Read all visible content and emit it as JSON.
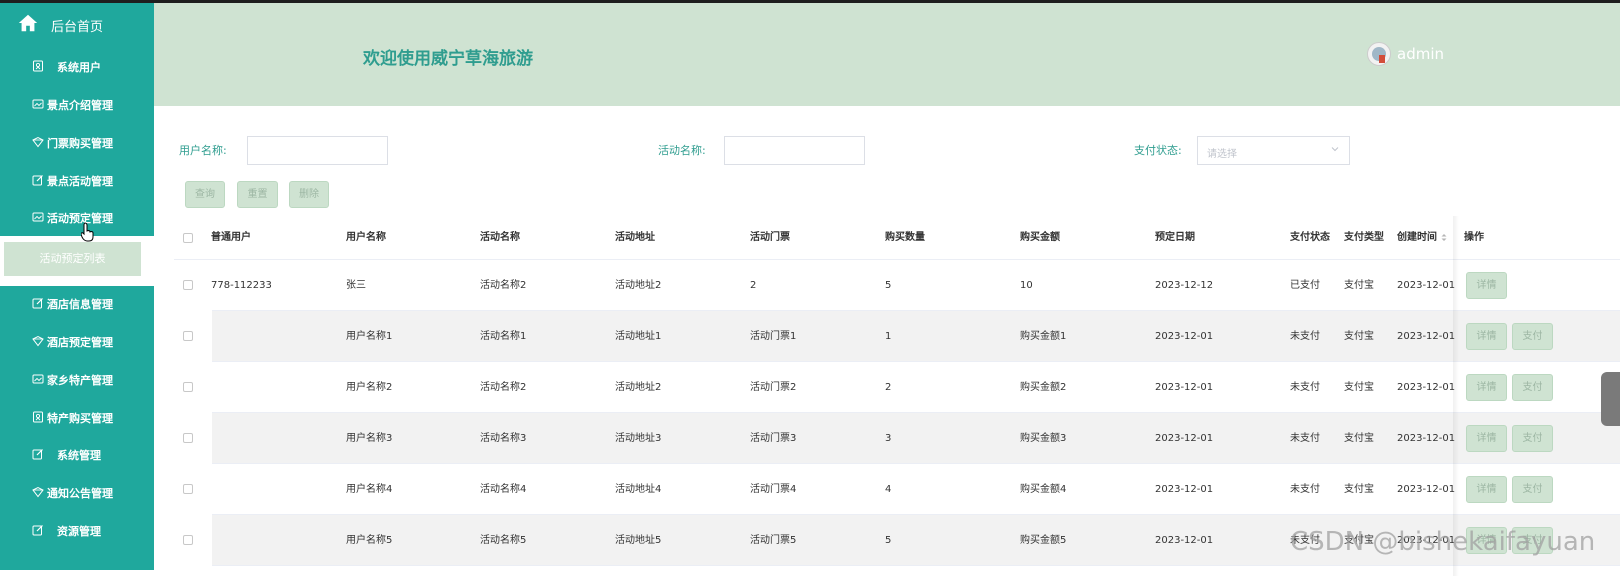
{
  "sidebar": {
    "home_label": "后台首页",
    "items": [
      {
        "label": "系统用户",
        "icon": "user-badge-icon"
      },
      {
        "label": "景点介绍管理",
        "icon": "image-icon"
      },
      {
        "label": "门票购买管理",
        "icon": "ticket-icon"
      },
      {
        "label": "景点活动管理",
        "icon": "edit-icon"
      },
      {
        "label": "活动预定管理",
        "icon": "image-icon"
      },
      {
        "label": "酒店信息管理",
        "icon": "edit-icon"
      },
      {
        "label": "酒店预定管理",
        "icon": "ticket-icon"
      },
      {
        "label": "家乡特产管理",
        "icon": "image-icon"
      },
      {
        "label": "特产购买管理",
        "icon": "user-badge-icon"
      },
      {
        "label": "系统管理",
        "icon": "edit-icon"
      },
      {
        "label": "通知公告管理",
        "icon": "ticket-icon"
      },
      {
        "label": "资源管理",
        "icon": "edit-icon"
      }
    ],
    "sub_item": "活动预定列表"
  },
  "header": {
    "title": "欢迎使用威宁草海旅游",
    "user": "admin"
  },
  "search": {
    "username_label": "用户名称:",
    "activity_label": "活动名称:",
    "pay_status_label": "支付状态:",
    "pay_status_placeholder": "请选择",
    "query_btn": "查询",
    "reset_btn": "重置",
    "delete_btn": "删除"
  },
  "table": {
    "columns": [
      "普通用户",
      "用户名称",
      "活动名称",
      "活动地址",
      "活动门票",
      "购买数量",
      "购买金额",
      "预定日期",
      "支付状态",
      "支付类型",
      "创建时间",
      "操作"
    ],
    "detail_btn": "详情",
    "pay_btn": "支付",
    "rows": [
      {
        "user": "778-112233",
        "name": "张三",
        "activity": "活动名称2",
        "address": "活动地址2",
        "ticket": "2",
        "qty": "5",
        "amount": "10",
        "date": "2023-12-12",
        "status": "已支付",
        "type": "支付宝",
        "created": "2023-12-01",
        "show_pay": false
      },
      {
        "user": "",
        "name": "用户名称1",
        "activity": "活动名称1",
        "address": "活动地址1",
        "ticket": "活动门票1",
        "qty": "1",
        "amount": "购买金额1",
        "date": "2023-12-01",
        "status": "未支付",
        "type": "支付宝",
        "created": "2023-12-01",
        "show_pay": true
      },
      {
        "user": "",
        "name": "用户名称2",
        "activity": "活动名称2",
        "address": "活动地址2",
        "ticket": "活动门票2",
        "qty": "2",
        "amount": "购买金额2",
        "date": "2023-12-01",
        "status": "未支付",
        "type": "支付宝",
        "created": "2023-12-01",
        "show_pay": true
      },
      {
        "user": "",
        "name": "用户名称3",
        "activity": "活动名称3",
        "address": "活动地址3",
        "ticket": "活动门票3",
        "qty": "3",
        "amount": "购买金额3",
        "date": "2023-12-01",
        "status": "未支付",
        "type": "支付宝",
        "created": "2023-12-01",
        "show_pay": true
      },
      {
        "user": "",
        "name": "用户名称4",
        "activity": "活动名称4",
        "address": "活动地址4",
        "ticket": "活动门票4",
        "qty": "4",
        "amount": "购买金额4",
        "date": "2023-12-01",
        "status": "未支付",
        "type": "支付宝",
        "created": "2023-12-01",
        "show_pay": true
      },
      {
        "user": "",
        "name": "用户名称5",
        "activity": "活动名称5",
        "address": "活动地址5",
        "ticket": "活动门票5",
        "qty": "5",
        "amount": "购买金额5",
        "date": "2023-12-01",
        "status": "未支付",
        "type": "支付宝",
        "created": "2023-12-01",
        "show_pay": true
      }
    ]
  },
  "watermark": "CSDN @bishekaifayuan",
  "colors": {
    "sidebar": "#1fa89d",
    "header": "#cfe3d2",
    "accent": "#2f9d8f"
  }
}
